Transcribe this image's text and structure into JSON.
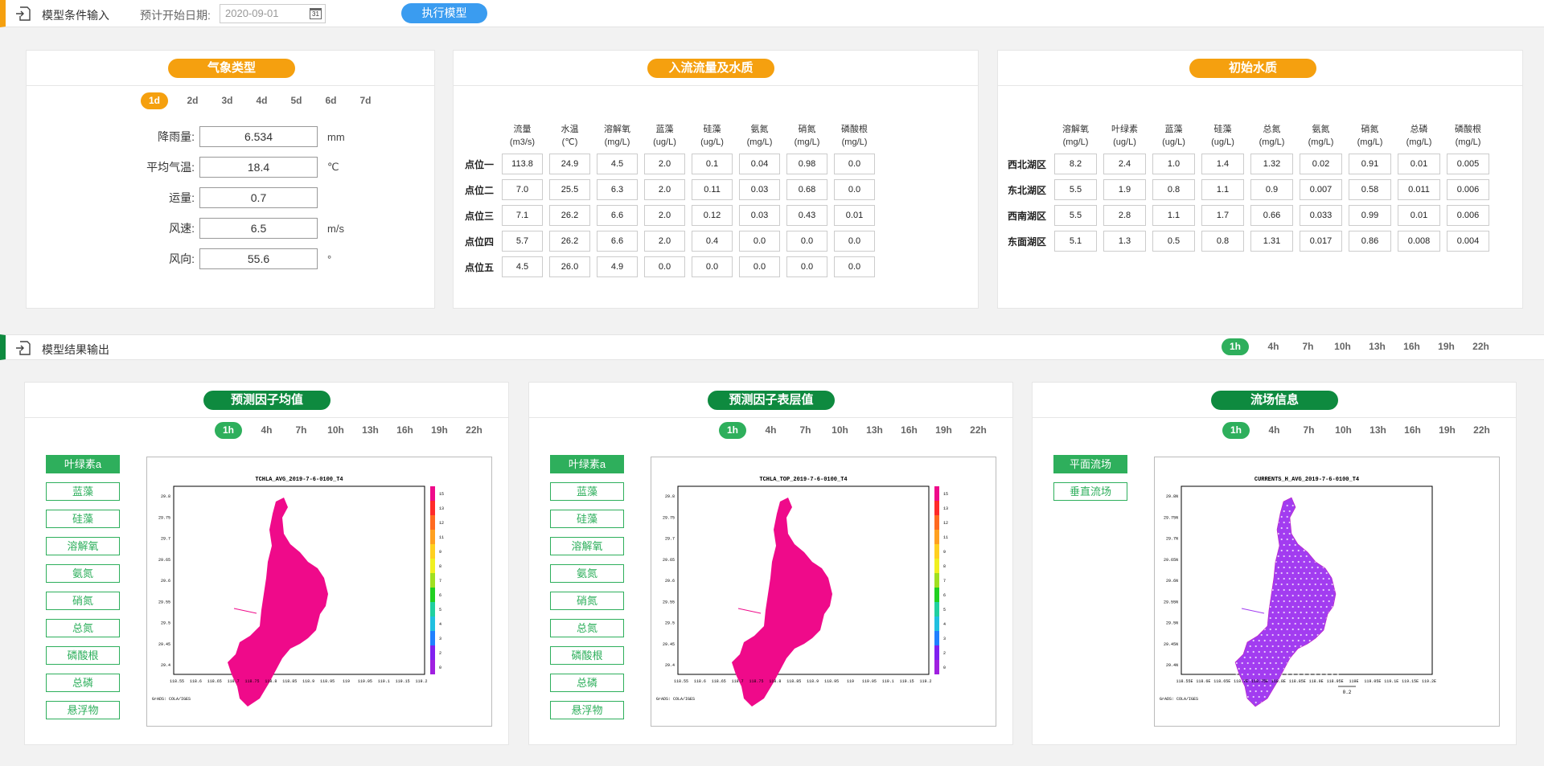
{
  "header": {
    "title": "模型条件输入",
    "date_label": "预计开始日期:",
    "date_value": "2020-09-01",
    "calendar_glyph": "31",
    "run_button": "执行模型"
  },
  "weather": {
    "title": "气象类型",
    "days": [
      "1d",
      "2d",
      "3d",
      "4d",
      "5d",
      "6d",
      "7d"
    ],
    "active_day": "1d",
    "rows": [
      {
        "label": "降雨量:",
        "value": "6.534",
        "unit": "mm"
      },
      {
        "label": "平均气温:",
        "value": "18.4",
        "unit": "℃"
      },
      {
        "label": "运量:",
        "value": "0.7",
        "unit": ""
      },
      {
        "label": "风速:",
        "value": "6.5",
        "unit": "m/s"
      },
      {
        "label": "风向:",
        "value": "55.6",
        "unit": "°"
      }
    ]
  },
  "inflow": {
    "title": "入流流量及水质",
    "headers": [
      [
        "流量",
        "(m3/s)"
      ],
      [
        "水温",
        "(℃)"
      ],
      [
        "溶解氧",
        "(mg/L)"
      ],
      [
        "蓝藻",
        "(ug/L)"
      ],
      [
        "硅藻",
        "(ug/L)"
      ],
      [
        "氨氮",
        "(mg/L)"
      ],
      [
        "硝氮",
        "(mg/L)"
      ],
      [
        "磷酸根",
        "(mg/L)"
      ]
    ],
    "rows": [
      {
        "label": "点位一",
        "values": [
          "113.8",
          "24.9",
          "4.5",
          "2.0",
          "0.1",
          "0.04",
          "0.98",
          "0.0"
        ]
      },
      {
        "label": "点位二",
        "values": [
          "7.0",
          "25.5",
          "6.3",
          "2.0",
          "0.11",
          "0.03",
          "0.68",
          "0.0"
        ]
      },
      {
        "label": "点位三",
        "values": [
          "7.1",
          "26.2",
          "6.6",
          "2.0",
          "0.12",
          "0.03",
          "0.43",
          "0.01"
        ]
      },
      {
        "label": "点位四",
        "values": [
          "5.7",
          "26.2",
          "6.6",
          "2.0",
          "0.4",
          "0.0",
          "0.0",
          "0.0"
        ]
      },
      {
        "label": "点位五",
        "values": [
          "4.5",
          "26.0",
          "4.9",
          "0.0",
          "0.0",
          "0.0",
          "0.0",
          "0.0"
        ]
      }
    ]
  },
  "initial": {
    "title": "初始水质",
    "headers": [
      [
        "溶解氧",
        "(mg/L)"
      ],
      [
        "叶绿素",
        "(ug/L)"
      ],
      [
        "蓝藻",
        "(ug/L)"
      ],
      [
        "硅藻",
        "(ug/L)"
      ],
      [
        "总氮",
        "(mg/L)"
      ],
      [
        "氨氮",
        "(mg/L)"
      ],
      [
        "硝氮",
        "(mg/L)"
      ],
      [
        "总磷",
        "(mg/L)"
      ],
      [
        "磷酸根",
        "(mg/L)"
      ]
    ],
    "rows": [
      {
        "label": "西北湖区",
        "values": [
          "8.2",
          "2.4",
          "1.0",
          "1.4",
          "1.32",
          "0.02",
          "0.91",
          "0.01",
          "0.005"
        ]
      },
      {
        "label": "东北湖区",
        "values": [
          "5.5",
          "1.9",
          "0.8",
          "1.1",
          "0.9",
          "0.007",
          "0.58",
          "0.011",
          "0.006"
        ]
      },
      {
        "label": "西南湖区",
        "values": [
          "5.5",
          "2.8",
          "1.1",
          "1.7",
          "0.66",
          "0.033",
          "0.99",
          "0.01",
          "0.006"
        ]
      },
      {
        "label": "东面湖区",
        "values": [
          "5.1",
          "1.3",
          "0.5",
          "0.8",
          "1.31",
          "0.017",
          "0.86",
          "0.008",
          "0.004"
        ]
      }
    ]
  },
  "output": {
    "title": "模型结果输出",
    "hours": [
      "1h",
      "4h",
      "7h",
      "10h",
      "13h",
      "16h",
      "19h",
      "22h"
    ],
    "active_hour": "1h"
  },
  "panels": [
    {
      "title": "预测因子均值",
      "hours": [
        "1h",
        "4h",
        "7h",
        "10h",
        "13h",
        "16h",
        "19h",
        "22h"
      ],
      "factors": [
        "叶绿素a",
        "蓝藻",
        "硅藻",
        "溶解氧",
        "氨氮",
        "硝氮",
        "总氮",
        "磷酸根",
        "总磷",
        "悬浮物"
      ],
      "active_factor": "叶绿素a",
      "map_title": "TCHLA_AVG_2019-7-6-0100_T4",
      "footer": "GrADS: COLA/IGES",
      "fill_color": "#ef0a8a",
      "xticks": [
        "118.55",
        "118.6",
        "118.65",
        "118.7",
        "118.75",
        "118.8",
        "118.85",
        "118.9",
        "118.95",
        "119",
        "119.05",
        "119.1",
        "119.15",
        "119.2"
      ],
      "yticks": [
        "29.8",
        "29.75",
        "29.7",
        "29.65",
        "29.6",
        "29.55",
        "29.5",
        "29.45",
        "29.4"
      ],
      "colorbar": [
        "15",
        "13",
        "12",
        "11",
        "9",
        "8",
        "7",
        "6",
        "5",
        "4",
        "3",
        "2",
        "0"
      ]
    },
    {
      "title": "预测因子表层值",
      "hours": [
        "1h",
        "4h",
        "7h",
        "10h",
        "13h",
        "16h",
        "19h",
        "22h"
      ],
      "factors": [
        "叶绿素a",
        "蓝藻",
        "硅藻",
        "溶解氧",
        "氨氮",
        "硝氮",
        "总氮",
        "磷酸根",
        "总磷",
        "悬浮物"
      ],
      "active_factor": "叶绿素a",
      "map_title": "TCHLA_TOP_2019-7-6-0100_T4",
      "footer": "GrADS: COLA/IGES",
      "fill_color": "#ef0a8a",
      "xticks": [
        "118.55",
        "118.6",
        "118.65",
        "118.7",
        "118.75",
        "118.8",
        "118.85",
        "118.9",
        "118.95",
        "119",
        "119.05",
        "119.1",
        "119.15",
        "119.2"
      ],
      "yticks": [
        "29.8",
        "29.75",
        "29.7",
        "29.65",
        "29.6",
        "29.55",
        "29.5",
        "29.45",
        "29.4"
      ],
      "colorbar": [
        "15",
        "13",
        "12",
        "11",
        "9",
        "8",
        "7",
        "6",
        "5",
        "4",
        "3",
        "2",
        "0"
      ]
    },
    {
      "title": "流场信息",
      "hours": [
        "1h",
        "4h",
        "7h",
        "10h",
        "13h",
        "16h",
        "19h",
        "22h"
      ],
      "factors": [
        "平面流场",
        "垂直流场"
      ],
      "active_factor": "平面流场",
      "map_title": "CURRENTS_H_AVG_2019-7-6-0100_T4",
      "footer": "GrADS: COLA/IGES",
      "fill_color": "#a23cf0",
      "xticks": [
        "118.55E",
        "118.6E",
        "118.65E",
        "118.7E",
        "118.75E",
        "118.8E",
        "118.85E",
        "118.9E",
        "118.95E",
        "119E",
        "119.05E",
        "119.1E",
        "119.15E",
        "119.2E"
      ],
      "yticks": [
        "29.8N",
        "29.75N",
        "29.7N",
        "29.65N",
        "29.6N",
        "29.55N",
        "29.5N",
        "29.45N",
        "29.4N"
      ],
      "scale_label": "0.2"
    }
  ],
  "colors": {
    "orange": "#f5a00f",
    "green_dark": "#0e8a3f",
    "green": "#2eaf5c",
    "blue": "#3a9cf0"
  }
}
